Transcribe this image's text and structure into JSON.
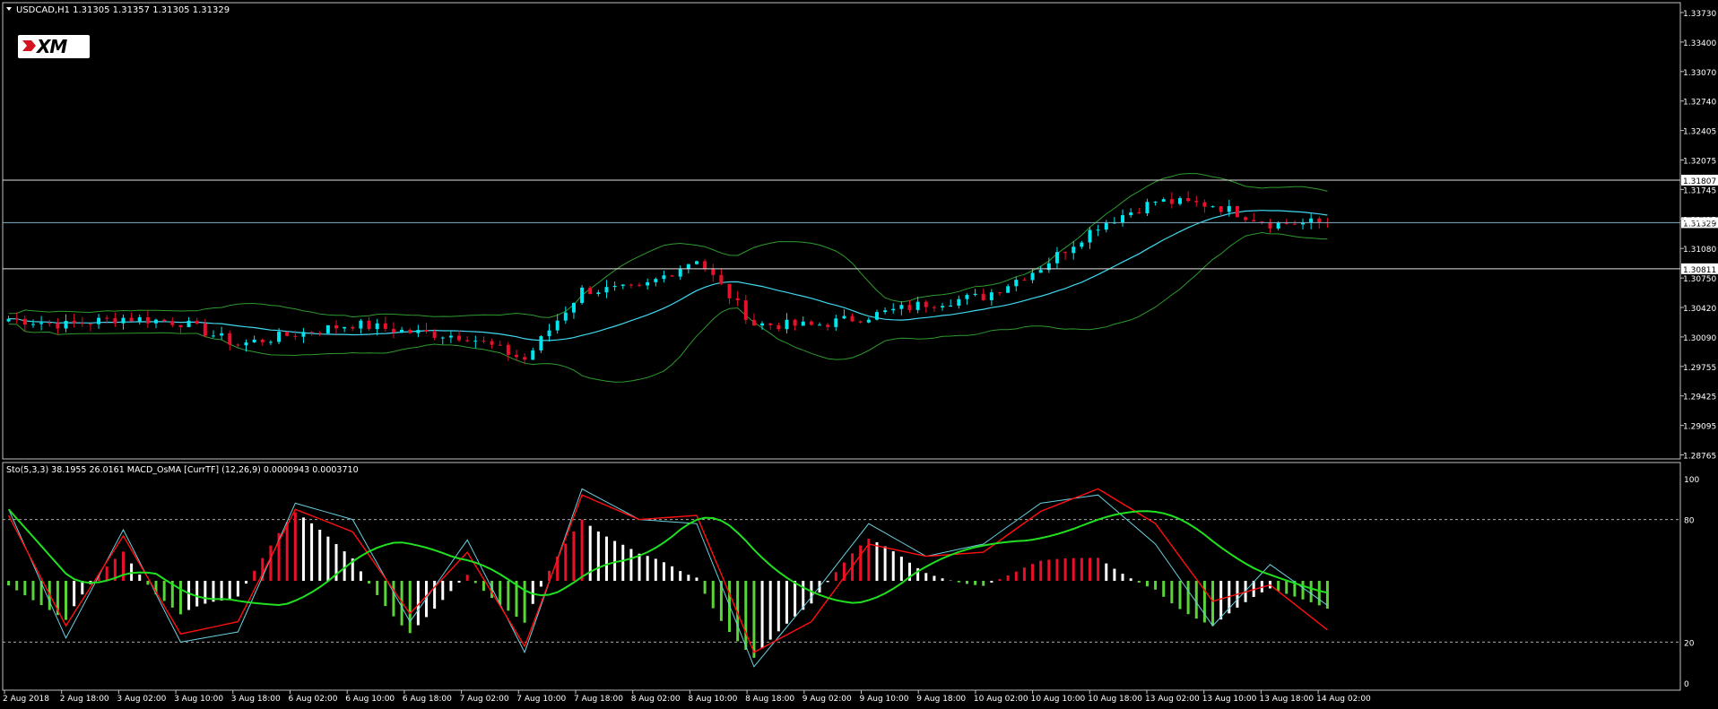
{
  "main": {
    "title": "USDCAD,H1  1.31305 1.31357 1.31305 1.31329",
    "logo_text": "XM",
    "price_labels": [
      "1.33730",
      "1.33400",
      "1.33070",
      "1.32740",
      "1.32405",
      "1.32075",
      "1.31745",
      "1.31415",
      "1.31080",
      "1.30750",
      "1.30420",
      "1.30090",
      "1.29755",
      "1.29425",
      "1.29095",
      "1.28765"
    ],
    "hlines": [
      {
        "value": 1.31807,
        "label": "1.31807"
      },
      {
        "value": 1.31329,
        "label": "1.31329"
      },
      {
        "value": 1.30811,
        "label": "1.30811"
      }
    ]
  },
  "sub": {
    "title": "Sto(5,3,3) 38.1955 26.0161  MACD_OsMA [CurrTF] (12,26,9) 0.0000943 0.0003710",
    "scale_labels": [
      "100",
      "80",
      "20",
      "0"
    ]
  },
  "time_labels": [
    "2 Aug 2018",
    "2 Aug 18:00",
    "3 Aug 02:00",
    "3 Aug 10:00",
    "3 Aug 18:00",
    "6 Aug 02:00",
    "6 Aug 10:00",
    "6 Aug 18:00",
    "7 Aug 02:00",
    "7 Aug 10:00",
    "7 Aug 18:00",
    "8 Aug 02:00",
    "8 Aug 10:00",
    "8 Aug 18:00",
    "9 Aug 02:00",
    "9 Aug 10:00",
    "9 Aug 18:00",
    "10 Aug 02:00",
    "10 Aug 10:00",
    "10 Aug 18:00",
    "13 Aug 02:00",
    "13 Aug 10:00",
    "13 Aug 18:00",
    "14 Aug 02:00"
  ],
  "colors": {
    "bull": "#00e5ee",
    "bear": "#e8102a",
    "ma": "#40d8f0",
    "bands": "#2e9a2e",
    "grid": "#c0c0c0",
    "sto_main": "#6ad0e0",
    "sto_signal": "#ff1010",
    "slow": "#20e020",
    "hist_up": "#e8102a",
    "hist_fade": "#ffffff",
    "hist_down": "#5ad43a"
  },
  "chart_data": [
    {
      "type": "candlestick",
      "title": "USDCAD,H1",
      "ylim": [
        1.28765,
        1.3373
      ],
      "x": [
        "2 Aug 2018",
        "2 Aug 18:00",
        "3 Aug 02:00",
        "3 Aug 10:00",
        "3 Aug 18:00",
        "6 Aug 02:00",
        "6 Aug 10:00",
        "6 Aug 18:00",
        "7 Aug 02:00",
        "7 Aug 10:00",
        "7 Aug 18:00",
        "8 Aug 02:00",
        "8 Aug 10:00",
        "8 Aug 18:00",
        "9 Aug 02:00",
        "9 Aug 10:00",
        "9 Aug 18:00",
        "10 Aug 02:00",
        "10 Aug 10:00",
        "10 Aug 18:00",
        "13 Aug 02:00",
        "13 Aug 10:00",
        "13 Aug 18:00",
        "14 Aug 02:00"
      ],
      "close": [
        1.3025,
        1.3018,
        1.3026,
        1.3021,
        1.2996,
        1.3008,
        1.3019,
        1.301,
        1.3005,
        1.2979,
        1.3057,
        1.3058,
        1.3093,
        1.3019,
        1.3017,
        1.3028,
        1.3042,
        1.305,
        1.3083,
        1.313,
        1.3157,
        1.3153,
        1.3132,
        1.3133
      ],
      "last": 1.31329,
      "indicators": [
        "Bollinger Bands",
        "Moving Average"
      ]
    },
    {
      "type": "line",
      "title": "Sto(5,3,3) 38.1955 26.0161  MACD_OsMA [CurrTF] (12,26,9) 0.0000943 0.0003710",
      "ylim": [
        0,
        100
      ],
      "series": [
        {
          "name": "Sto(5,3,3)",
          "values": [
            85,
            22,
            75,
            20,
            25,
            88,
            80,
            30,
            70,
            15,
            95,
            80,
            78,
            8,
            42,
            78,
            62,
            68,
            88,
            92,
            68,
            28,
            58,
            38
          ]
        },
        {
          "name": "Signal",
          "values": [
            82,
            28,
            72,
            24,
            30,
            85,
            74,
            34,
            64,
            18,
            92,
            80,
            82,
            15,
            30,
            68,
            62,
            64,
            84,
            95,
            78,
            40,
            48,
            26
          ]
        }
      ]
    }
  ]
}
